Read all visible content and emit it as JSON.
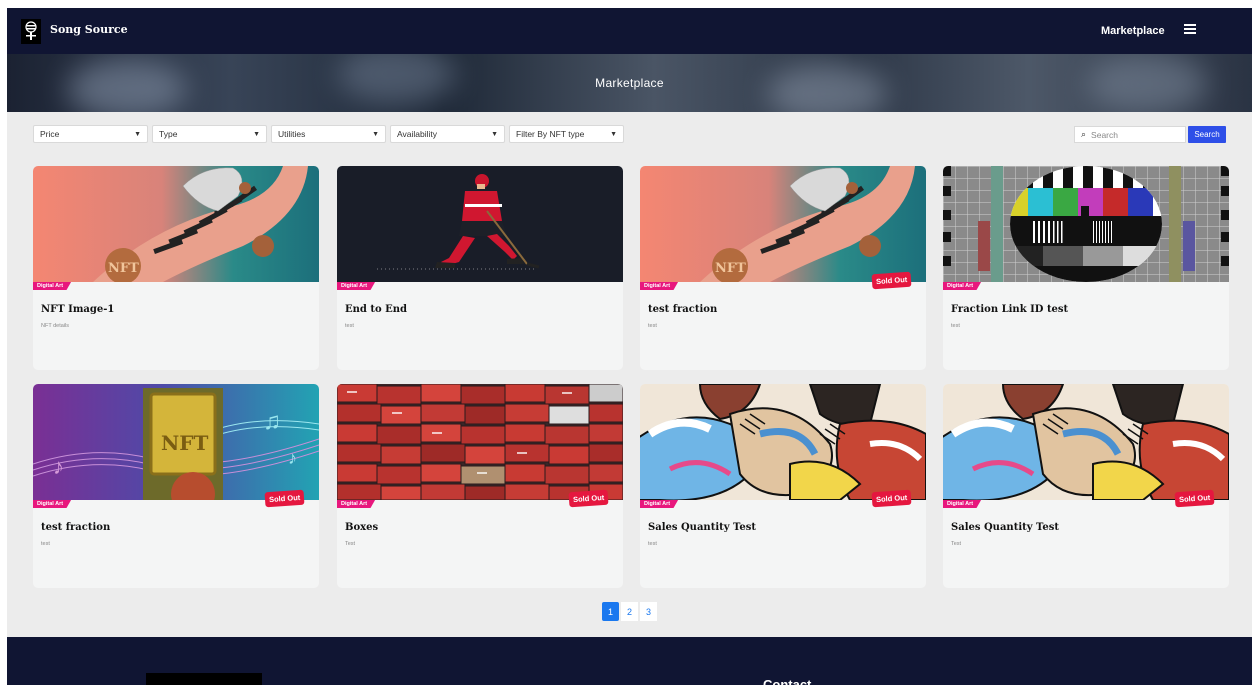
{
  "header": {
    "brand": "Song Source",
    "nav_marketplace": "Marketplace",
    "menu_icon": "hamburger-icon",
    "logo_icon": "song-source-logo-icon"
  },
  "banner": {
    "title": "Marketplace"
  },
  "filters": [
    {
      "label": "Price"
    },
    {
      "label": "Type"
    },
    {
      "label": "Utilities"
    },
    {
      "label": "Availability"
    },
    {
      "label": "Filter By NFT type"
    }
  ],
  "search": {
    "placeholder": "Search",
    "button": "Search",
    "icon": "search-icon"
  },
  "cards": [
    {
      "title": "NFT Image-1",
      "desc": "NFT details",
      "category": "Digital Art",
      "sold_out": "",
      "image": "piano-hand-nft"
    },
    {
      "title": "End to End",
      "desc": "test",
      "category": "Digital Art",
      "sold_out": "",
      "image": "hockey-player"
    },
    {
      "title": "test fraction",
      "desc": "test",
      "category": "Digital Art",
      "sold_out": "Sold Out",
      "image": "piano-hand-nft"
    },
    {
      "title": "Fraction Link ID test",
      "desc": "test",
      "category": "Digital Art",
      "sold_out": "",
      "image": "tv-test-pattern"
    },
    {
      "title": "test fraction",
      "desc": "test",
      "category": "Digital Art",
      "sold_out": "Sold Out",
      "image": "gold-nft-music"
    },
    {
      "title": "Boxes",
      "desc": "Test",
      "category": "Digital Art",
      "sold_out": "Sold Out",
      "image": "shoe-boxes"
    },
    {
      "title": "Sales Quantity Test",
      "desc": "test",
      "category": "Digital Art",
      "sold_out": "Sold Out",
      "image": "sneakers-art"
    },
    {
      "title": "Sales Quantity Test",
      "desc": "Test",
      "category": "Digital Art",
      "sold_out": "Sold Out",
      "image": "sneakers-art"
    }
  ],
  "pagination": {
    "pages": [
      "1",
      "2",
      "3"
    ],
    "active": "1"
  },
  "footer": {
    "contact": "Contact"
  },
  "colors": {
    "nav": "#101533",
    "accent": "#2e4fe8",
    "category_badge": "#e8177d",
    "sold_badge": "#e5173f",
    "page_active": "#1a78ef"
  }
}
